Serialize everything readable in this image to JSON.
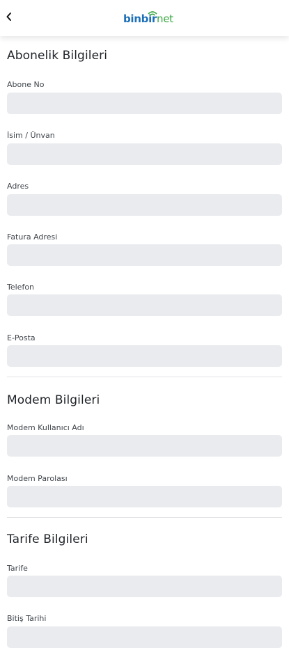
{
  "header": {
    "back_icon": "chevron-left-icon",
    "logo_part1": "binbir",
    "logo_part2": "net",
    "brand_colors": {
      "primary": "#1c6fb8",
      "accent": "#3aa743"
    }
  },
  "sections": {
    "abonelik": {
      "title": "Abonelik Bilgileri",
      "fields": {
        "abone_no": {
          "label": "Abone No",
          "value": ""
        },
        "isim": {
          "label": "İsim / Ünvan",
          "value": ""
        },
        "adres": {
          "label": "Adres",
          "value": ""
        },
        "fatura_adresi": {
          "label": "Fatura Adresi",
          "value": ""
        },
        "telefon": {
          "label": "Telefon",
          "value": ""
        },
        "eposta": {
          "label": "E-Posta",
          "value": ""
        }
      }
    },
    "modem": {
      "title": "Modem Bilgileri",
      "fields": {
        "kullanici_adi": {
          "label": "Modem Kullanıcı Adı",
          "value": ""
        },
        "parola": {
          "label": "Modem Parolası",
          "value": ""
        }
      }
    },
    "tarife": {
      "title": "Tarife Bilgileri",
      "fields": {
        "tarife": {
          "label": "Tarife",
          "value": ""
        },
        "bitis_tarihi": {
          "label": "Bitiş Tarihi",
          "value": ""
        }
      }
    }
  },
  "colors": {
    "field_bg": "#e9ebee",
    "divider": "#e2e4e7"
  }
}
